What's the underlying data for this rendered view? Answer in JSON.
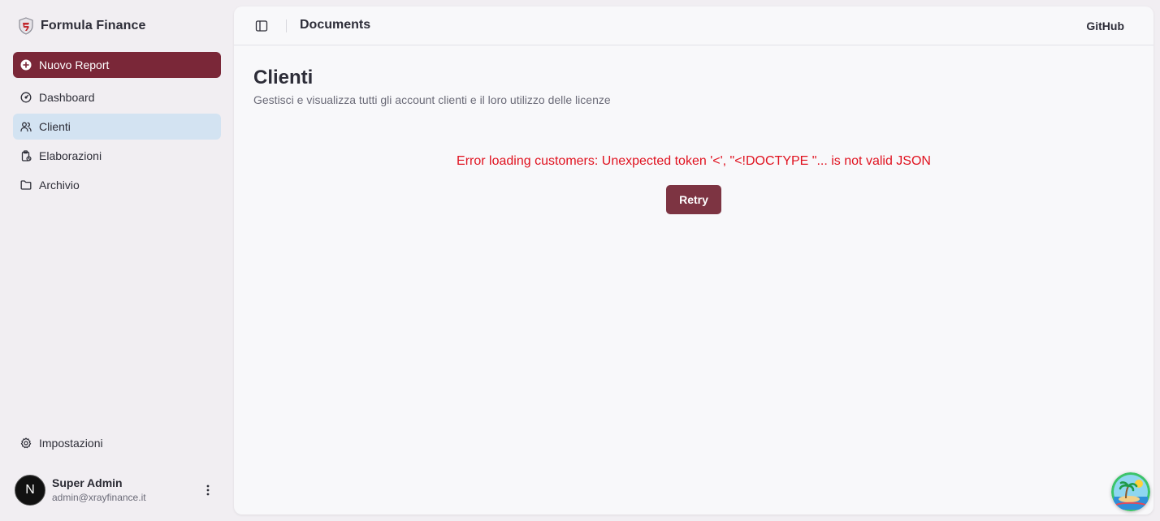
{
  "brand": {
    "name": "Formula Finance",
    "logo_icon": "shield-logo-icon",
    "accent": "#7a2738"
  },
  "sidebar": {
    "new_report": {
      "label": "Nuovo Report",
      "icon": "plus-circle-icon"
    },
    "items": [
      {
        "label": "Dashboard",
        "icon": "gauge-icon",
        "active": false
      },
      {
        "label": "Clienti",
        "icon": "users-icon",
        "active": true
      },
      {
        "label": "Elaborazioni",
        "icon": "clipboard-icon",
        "active": false
      },
      {
        "label": "Archivio",
        "icon": "folder-icon",
        "active": false
      }
    ],
    "settings": {
      "label": "Impostazioni",
      "icon": "gear-icon"
    }
  },
  "user": {
    "avatar_initial": "N",
    "name": "Super Admin",
    "email": "admin@xrayfinance.it",
    "menu_icon": "vertical-dots-icon"
  },
  "topbar": {
    "toggle_icon": "sidebar-toggle-icon",
    "title": "Documents",
    "github_label": "GitHub"
  },
  "main": {
    "title": "Clienti",
    "subtitle": "Gestisci e visualizza tutti gli account clienti e il loro utilizzo delle licenze",
    "error_message": "Error loading customers: Unexpected token '<', \"<!DOCTYPE \"... is not valid JSON",
    "error_color": "#e0121f",
    "retry_label": "Retry"
  },
  "floating_badge": {
    "icon": "island-avatar-icon"
  }
}
